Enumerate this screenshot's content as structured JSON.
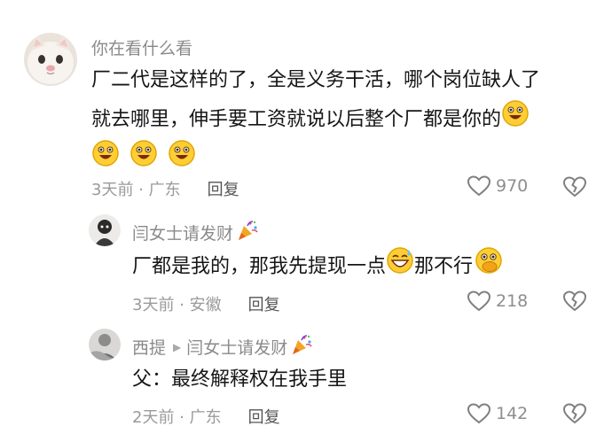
{
  "comments": [
    {
      "username": "你在看什么看",
      "text_line1": "厂二代是这样的了，全是义务干活，哪个岗位缺人了",
      "text_line2": "就去哪里，伸手要工资就说以后整个厂都是你的",
      "time_location": "3天前 · 广东",
      "reply_label": "回复",
      "likes": "970"
    },
    {
      "username": "闫女士请发财",
      "text_part1": "厂都是我的，那我先提现一点",
      "text_part2": "那不行",
      "time_location": "3天前 · 安徽",
      "reply_label": "回复",
      "likes": "218"
    },
    {
      "username": "西提",
      "reply_to": "闫女士请发财",
      "text": "父：最终解释权在我手里",
      "time_location": "2天前 · 广东",
      "reply_label": "回复",
      "likes": "142"
    }
  ]
}
